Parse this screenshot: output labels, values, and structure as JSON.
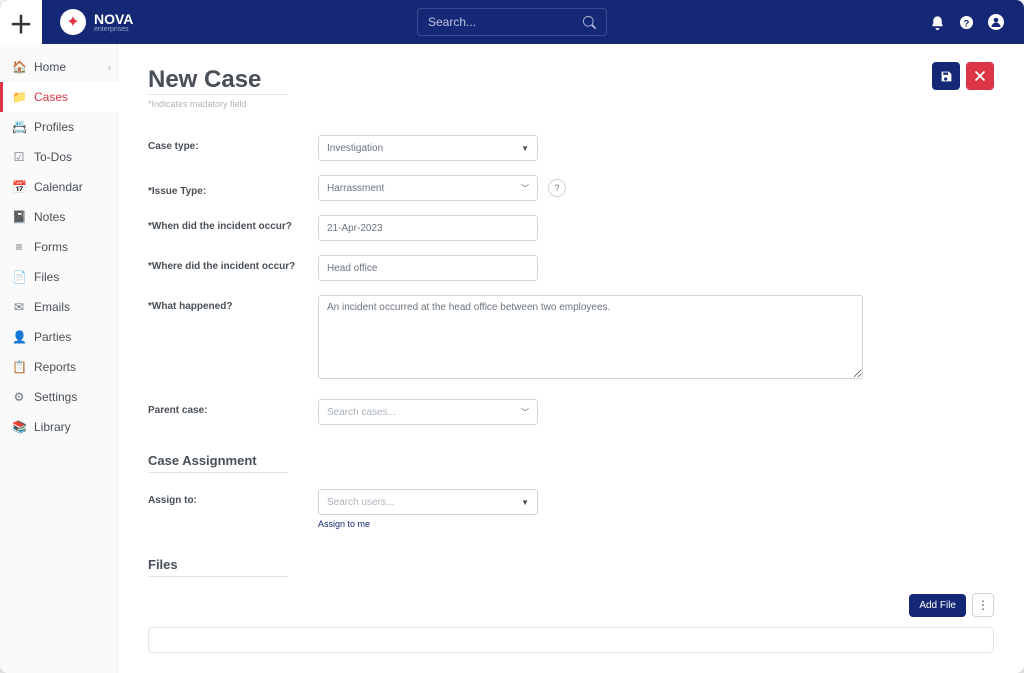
{
  "brand": {
    "name": "NOVA",
    "sub": "enterprises"
  },
  "search": {
    "placeholder": "Search..."
  },
  "sidebar": {
    "items": [
      {
        "icon": "home-icon",
        "label": "Home",
        "chev": true
      },
      {
        "icon": "folder-icon",
        "label": "Cases",
        "active": true
      },
      {
        "icon": "profile-icon",
        "label": "Profiles"
      },
      {
        "icon": "check-icon",
        "label": "To-Dos"
      },
      {
        "icon": "calendar-icon",
        "label": "Calendar"
      },
      {
        "icon": "notes-icon",
        "label": "Notes"
      },
      {
        "icon": "forms-icon",
        "label": "Forms"
      },
      {
        "icon": "files-icon",
        "label": "Files"
      },
      {
        "icon": "emails-icon",
        "label": "Emails"
      },
      {
        "icon": "parties-icon",
        "label": "Parties"
      },
      {
        "icon": "reports-icon",
        "label": "Reports"
      },
      {
        "icon": "settings-icon",
        "label": "Settings"
      },
      {
        "icon": "library-icon",
        "label": "Library"
      }
    ]
  },
  "page": {
    "title": "New Case",
    "mandatory": "*Indicates madatory field",
    "save_icon": "save",
    "cancel_icon": "close"
  },
  "form": {
    "caseType": {
      "label": "Case type:",
      "value": "Investigation"
    },
    "issueType": {
      "label": "*Issue Type:",
      "value": "Harrassment"
    },
    "when": {
      "label": "*When did the incident occur?",
      "value": "21-Apr-2023"
    },
    "where": {
      "label": "*Where did the incident occur?",
      "value": "Head office"
    },
    "what": {
      "label": "*What happened?",
      "value": "An incident occurred at the head office between two employees."
    },
    "parentCase": {
      "label": "Parent case:",
      "placeholder": "Search cases..."
    }
  },
  "assignment": {
    "heading": "Case Assignment",
    "assignTo": {
      "label": "Assign to:",
      "placeholder": "Search users..."
    },
    "assignToMe": "Assign to me"
  },
  "files": {
    "heading": "Files",
    "addFile": "Add File"
  },
  "icons": {
    "home": "🏠",
    "folder": "📁",
    "profile": "📇",
    "check": "☑",
    "calendar": "📅",
    "notes": "📓",
    "forms": "≡",
    "files": "📄",
    "emails": "✉",
    "parties": "👤",
    "reports": "📋",
    "settings": "⚙",
    "library": "📚"
  }
}
